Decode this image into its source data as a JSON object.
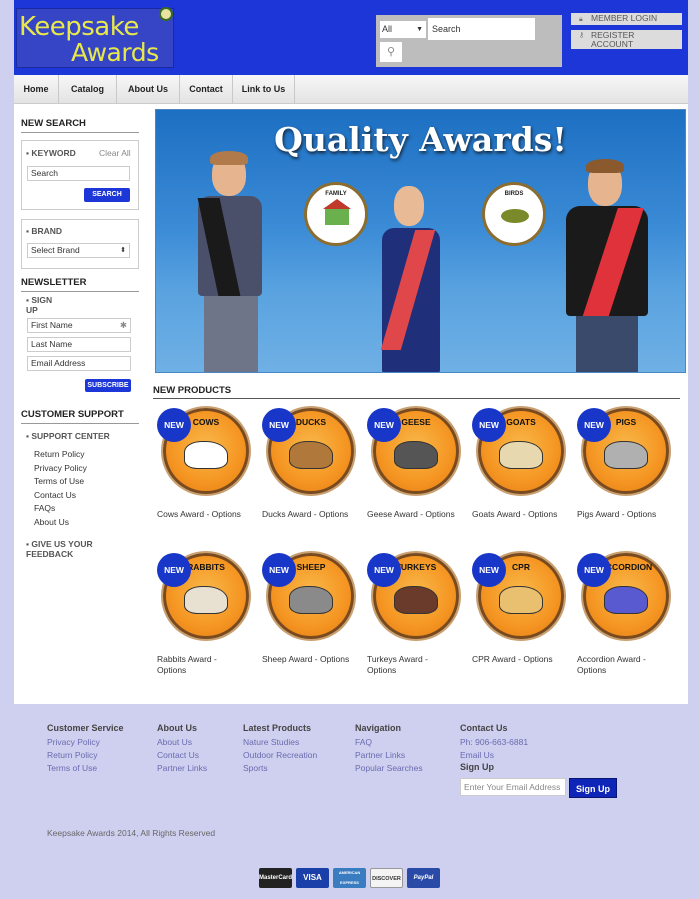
{
  "brand": {
    "name_line1": "Keepsake",
    "name_line2": "Awards"
  },
  "header": {
    "search_category": "All",
    "search_placeholder": "Search",
    "member_login": "MEMBER LOGIN",
    "register_line1": "REGISTER",
    "register_line2": "ACCOUNT"
  },
  "nav": [
    "Home",
    "Catalog",
    "About Us",
    "Contact",
    "Link to Us"
  ],
  "sidebar": {
    "new_search": "NEW SEARCH",
    "keyword": "KEYWORD",
    "clear_all": "Clear All",
    "search_value": "Search",
    "search_button": "SEARCH",
    "brand": "BRAND",
    "brand_select": "Select Brand",
    "newsletter": "NEWSLETTER",
    "sign_up": "SIGN UP",
    "first_name": "First Name",
    "last_name": "Last Name",
    "email": "Email Address",
    "subscribe": "SUBSCRIBE",
    "customer_support": "CUSTOMER SUPPORT",
    "support_center": "SUPPORT CENTER",
    "support_links": [
      "Return Policy",
      "Privacy Policy",
      "Terms of Use",
      "Contact Us",
      "FAQs",
      "About Us"
    ],
    "feedback": "GIVE US YOUR FEEDBACK"
  },
  "hero": {
    "title": "Quality Awards!",
    "medal_family": "FAMILY",
    "medal_birds": "BIRDS"
  },
  "new_products": {
    "title": "NEW PRODUCTS",
    "badge": "NEW",
    "items": [
      {
        "badge_text": "COWS",
        "caption": "Cows Award - Options"
      },
      {
        "badge_text": "DUCKS",
        "caption": "Ducks Award - Options"
      },
      {
        "badge_text": "GEESE",
        "caption": "Geese Award - Options"
      },
      {
        "badge_text": "GOATS",
        "caption": "Goats Award - Options"
      },
      {
        "badge_text": "PIGS",
        "caption": "Pigs Award - Options"
      },
      {
        "badge_text": "RABBITS",
        "caption": "Rabbits Award - Options"
      },
      {
        "badge_text": "SHEEP",
        "caption": "Sheep Award - Options"
      },
      {
        "badge_text": "TURKEYS",
        "caption": "Turkeys Award - Options"
      },
      {
        "badge_text": "CPR",
        "caption": "CPR Award - Options"
      },
      {
        "badge_text": "ACCORDION",
        "caption": "Accordion Award - Options"
      }
    ]
  },
  "footer": {
    "customer_service": {
      "title": "Customer Service",
      "links": [
        "Privacy Policy",
        "Return Policy",
        "Terms of Use"
      ]
    },
    "about_us": {
      "title": "About Us",
      "links": [
        "About Us",
        "Contact Us",
        "Partner Links"
      ]
    },
    "latest_products": {
      "title": "Latest Products",
      "links": [
        "Nature Studies",
        "Outdoor Recreation",
        "Sports"
      ]
    },
    "navigation": {
      "title": "Navigation",
      "links": [
        "FAQ",
        "Partner Links",
        "Popular Searches"
      ]
    },
    "contact": {
      "title": "Contact Us",
      "phone": "Ph: 906-663-6881",
      "email": "Email Us",
      "signup_title": "Sign Up",
      "email_placeholder": "Enter Your Email Address",
      "signup_button": "Sign Up"
    },
    "copyright": "Keepsake Awards 2014, All Rights Reserved",
    "payment": [
      "MasterCard",
      "VISA",
      "AMERICAN EXPRESS",
      "DISCOVER",
      "PayPal"
    ]
  },
  "colors": {
    "brand_blue": "#1c36d8",
    "page_bg": "#cfd0ef",
    "award_orange": "#f59522"
  }
}
